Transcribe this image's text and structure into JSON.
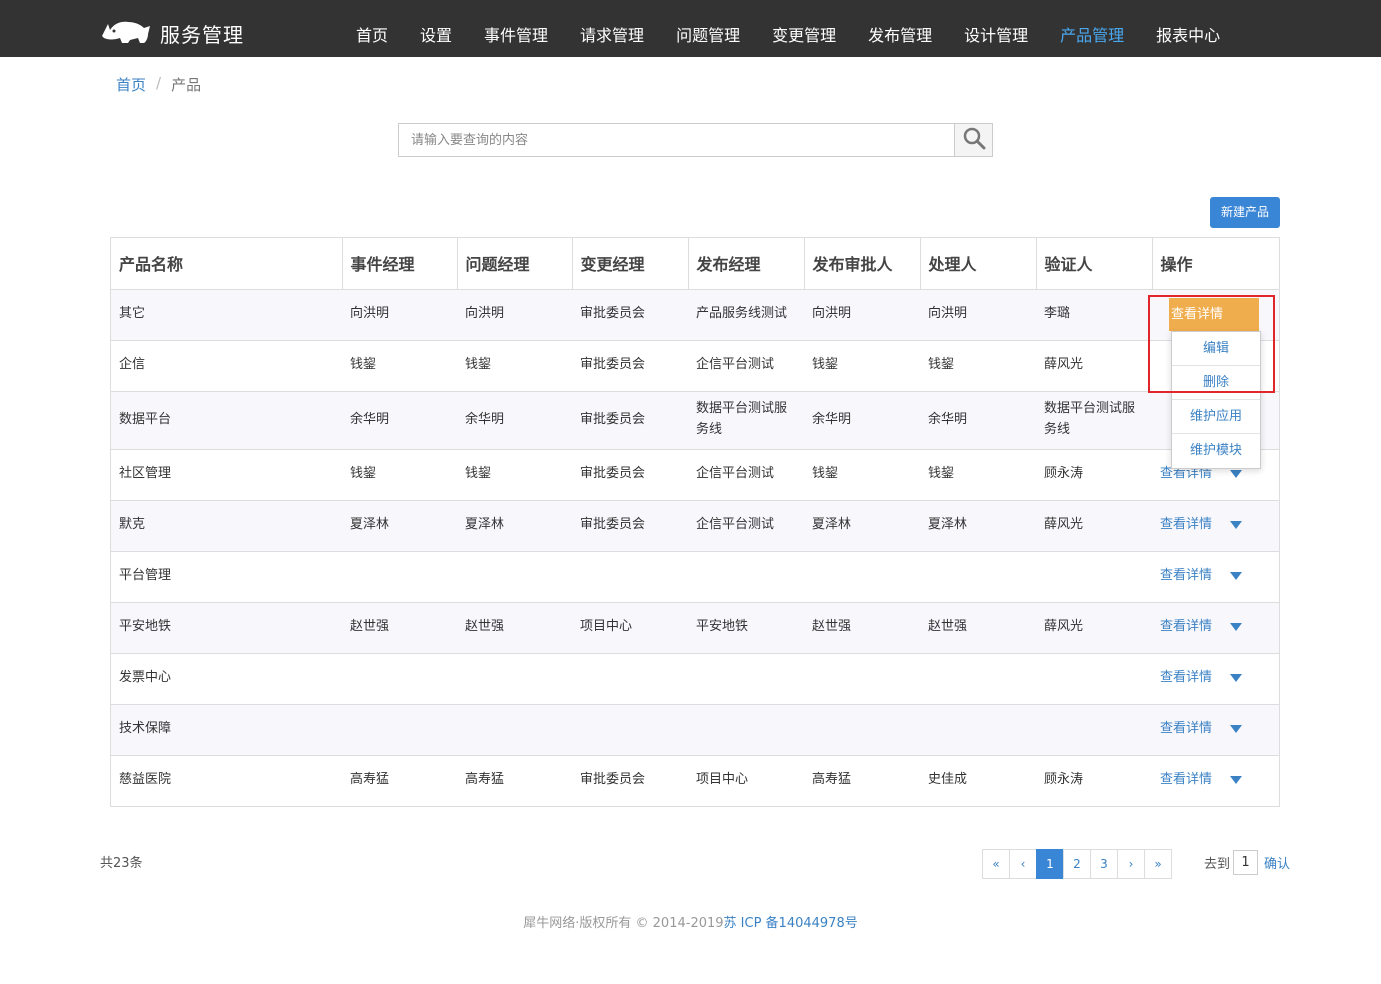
{
  "header": {
    "brand": "服务管理",
    "nav": [
      {
        "label": "首页",
        "active": false
      },
      {
        "label": "设置",
        "active": false
      },
      {
        "label": "事件管理",
        "active": false
      },
      {
        "label": "请求管理",
        "active": false
      },
      {
        "label": "问题管理",
        "active": false
      },
      {
        "label": "变更管理",
        "active": false
      },
      {
        "label": "发布管理",
        "active": false
      },
      {
        "label": "设计管理",
        "active": false
      },
      {
        "label": "产品管理",
        "active": true
      },
      {
        "label": "报表中心",
        "active": false
      }
    ],
    "accent_color": "#4aa8f0",
    "bg_color": "#333333"
  },
  "breadcrumb": {
    "home": "首页",
    "separator": "/",
    "current": "产品"
  },
  "search": {
    "placeholder": "请输入要查询的内容",
    "value": "",
    "icon": "search-icon"
  },
  "toolbar": {
    "new_button": "新建产品"
  },
  "table": {
    "columns": [
      "产品名称",
      "事件经理",
      "问题经理",
      "变更经理",
      "发布经理",
      "发布审批人",
      "处理人",
      "验证人",
      "操作"
    ],
    "view_label": "查看详情",
    "rows": [
      [
        "其它",
        "向洪明",
        "向洪明",
        "审批委员会",
        "产品服务线测试",
        "向洪明",
        "向洪明",
        "李璐"
      ],
      [
        "企信",
        "钱鋆",
        "钱鋆",
        "审批委员会",
        "企信平台测试",
        "钱鋆",
        "钱鋆",
        "薛风光"
      ],
      [
        "数据平台",
        "余华明",
        "余华明",
        "审批委员会",
        "数据平台测试服务线",
        "余华明",
        "余华明",
        "数据平台测试服务线"
      ],
      [
        "社区管理",
        "钱鋆",
        "钱鋆",
        "审批委员会",
        "企信平台测试",
        "钱鋆",
        "钱鋆",
        "顾永涛"
      ],
      [
        "默克",
        "夏泽林",
        "夏泽林",
        "审批委员会",
        "企信平台测试",
        "夏泽林",
        "夏泽林",
        "薛风光"
      ],
      [
        "平台管理",
        "",
        "",
        "",
        "",
        "",
        "",
        ""
      ],
      [
        "平安地铁",
        "赵世强",
        "赵世强",
        "项目中心",
        "平安地铁",
        "赵世强",
        "赵世强",
        "薛风光"
      ],
      [
        "发票中心",
        "",
        "",
        "",
        "",
        "",
        "",
        ""
      ],
      [
        "技术保障",
        "",
        "",
        "",
        "",
        "",
        "",
        ""
      ],
      [
        "慈益医院",
        "高寿猛",
        "高寿猛",
        "审批委员会",
        "项目中心",
        "高寿猛",
        "史佳成",
        "顾永涛"
      ]
    ]
  },
  "dropdown": {
    "active_label": "查看详情",
    "items": [
      "编辑",
      "删除",
      "维护应用",
      "维护模块"
    ]
  },
  "pagination": {
    "total": "共23条",
    "first": "«",
    "prev": "‹",
    "pages": [
      "1",
      "2",
      "3"
    ],
    "current": "1",
    "next": "›",
    "last": "»",
    "goto_label": "去到",
    "goto_value": "1",
    "confirm": "确认"
  },
  "footer": {
    "copyright": "犀牛网络·版权所有 © 2014-2019",
    "icp": "苏 ICP 备14044978号"
  }
}
